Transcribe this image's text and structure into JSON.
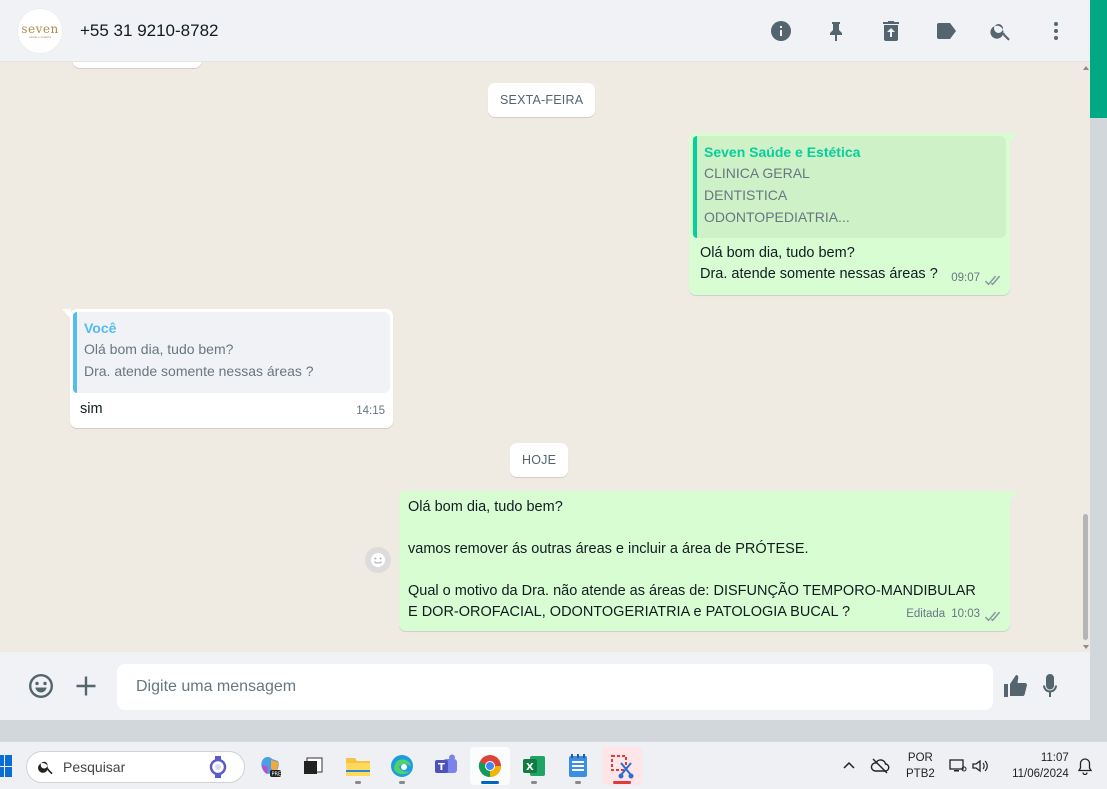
{
  "header": {
    "avatar_logo": "seven",
    "avatar_sub": "saúde e estética",
    "contact": "+55 31 9210-8782",
    "icons": [
      "info-icon",
      "pin-icon",
      "delete-icon",
      "label-icon",
      "search-icon",
      "menu-icon"
    ]
  },
  "chat": {
    "date_friday": "SEXTA-FEIRA",
    "date_today": "HOJE",
    "msg1": {
      "quote_author": "Seven Saúde e Estética",
      "quote_lines": [
        "CLINICA GERAL",
        "DENTISTICA",
        "ODONTOPEDIATRIA..."
      ],
      "text": "Olá bom dia, tudo bem?\nDra. atende somente nessas áreas ?",
      "time": "09:07"
    },
    "msg2": {
      "quote_author": "Você",
      "quote_lines": [
        "Olá bom dia, tudo bem?",
        "Dra. atende somente nessas áreas ?"
      ],
      "text": "sim",
      "time": "14:15"
    },
    "msg3": {
      "text": "Olá bom dia, tudo bem?\n\nvamos remover ás outras áreas e incluir a área de PRÓTESE.\n\nQual o motivo da Dra. não atende as áreas de: DISFUNÇÃO TEMPORO-MANDIBULAR\nE DOR-OROFACIAL, ODONTOGERIATRIA e PATOLOGIA BUCAL ?",
      "edited": "Editada",
      "time": "10:03"
    }
  },
  "composer": {
    "placeholder": "Digite uma mensagem",
    "icons": [
      "emoji-icon",
      "plus-icon",
      "thumbs-up-icon",
      "microphone-icon"
    ]
  },
  "taskbar": {
    "search_placeholder": "Pesquisar",
    "lang_top": "POR",
    "lang_bottom": "PTB2",
    "time": "11:07",
    "date": "11/06/2024",
    "apps": [
      "copilot-app",
      "window-app",
      "file-explorer",
      "edge-browser",
      "teams",
      "chrome",
      "excel",
      "notepad",
      "snipping-tool"
    ]
  },
  "colors": {
    "accent": "#00a884",
    "outgoing_bubble": "#d9fdd3",
    "incoming_bubble": "#ffffff",
    "chat_bg": "#efeae2"
  }
}
